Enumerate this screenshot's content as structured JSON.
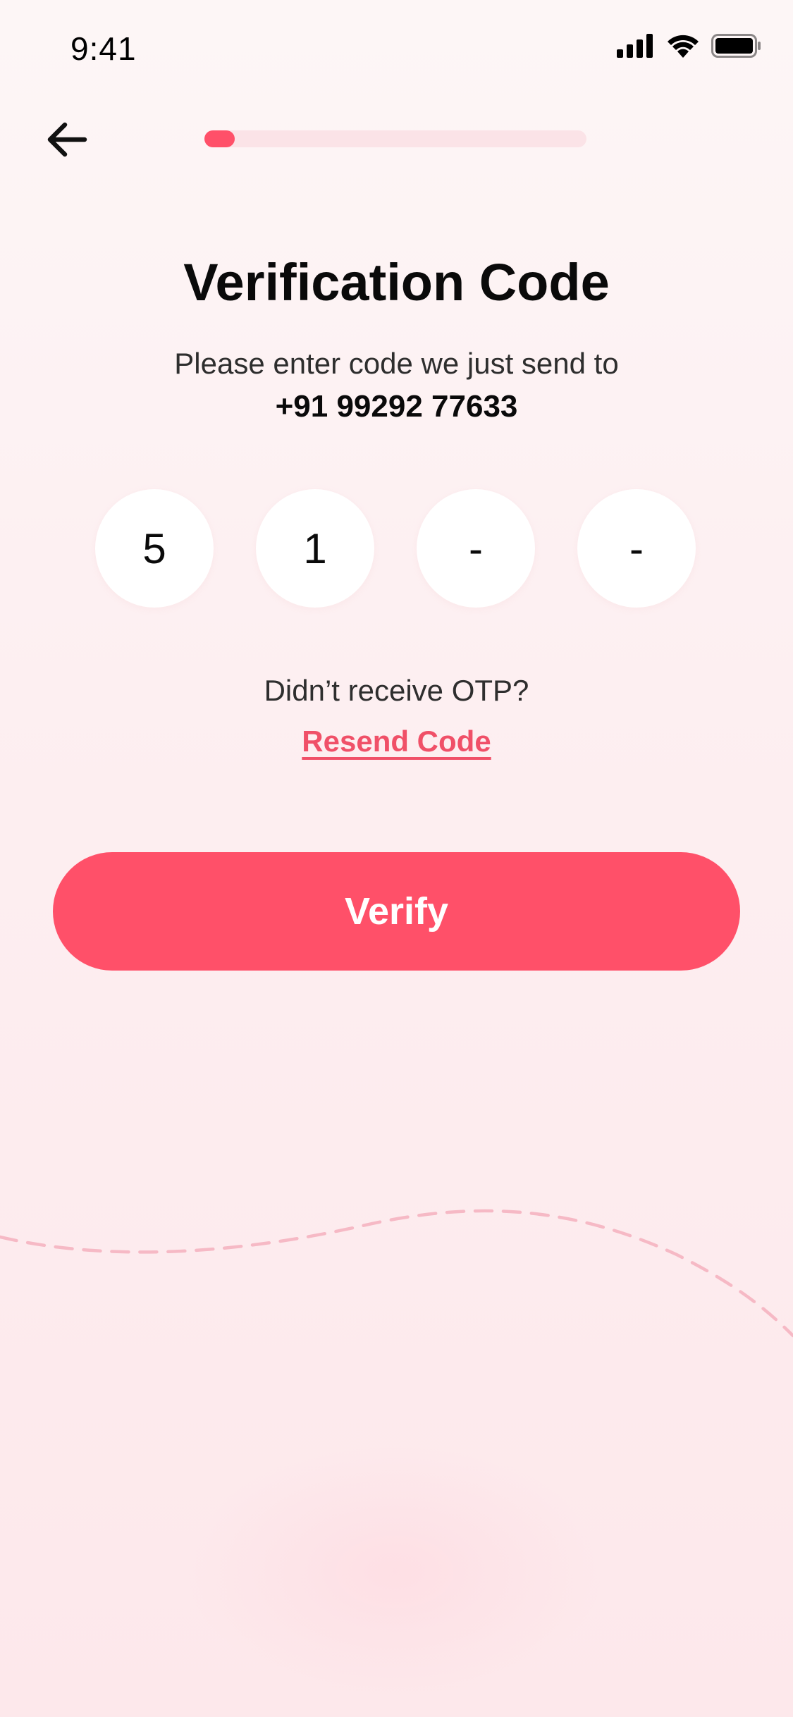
{
  "status_bar": {
    "time": "9:41"
  },
  "nav": {
    "back_icon": "arrow-left-icon",
    "progress_fraction": 0.08
  },
  "header": {
    "title": "Verification Code",
    "subtitle": "Please enter code we just send to",
    "phone": "+91 99292 77633"
  },
  "otp": {
    "digits": [
      "5",
      "1",
      "-",
      "-"
    ]
  },
  "resend": {
    "prompt": "Didn’t receive OTP?",
    "link_label": "Resend Code"
  },
  "verify": {
    "label": "Verify"
  },
  "colors": {
    "accent": "#ff5069",
    "link": "#f05068",
    "track": "#fbe3e7",
    "background_top": "#fdf6f6",
    "background_bottom": "#fde8eb",
    "wave": "#f6b9c5"
  }
}
